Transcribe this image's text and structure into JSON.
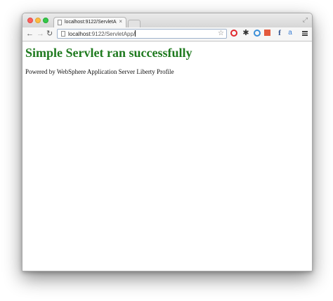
{
  "browser": {
    "tab": {
      "title": "localhost:9122/ServletApp",
      "close_glyph": "×"
    },
    "url": {
      "host": "localhost",
      "path": ":9122/ServletApp/"
    },
    "extensions": [
      "opera-icon",
      "gear-icon",
      "clock-icon",
      "red-square-icon",
      "facebook-icon",
      "translate-icon"
    ],
    "extension_glyphs": {
      "facebook": "f",
      "translate": "a",
      "gear": "✱"
    }
  },
  "page": {
    "heading": "Simple Servlet ran successfully",
    "powered_by": "Powered by WebSphere Application Server Liberty Profile"
  },
  "colors": {
    "heading": "#1f7a1f"
  }
}
